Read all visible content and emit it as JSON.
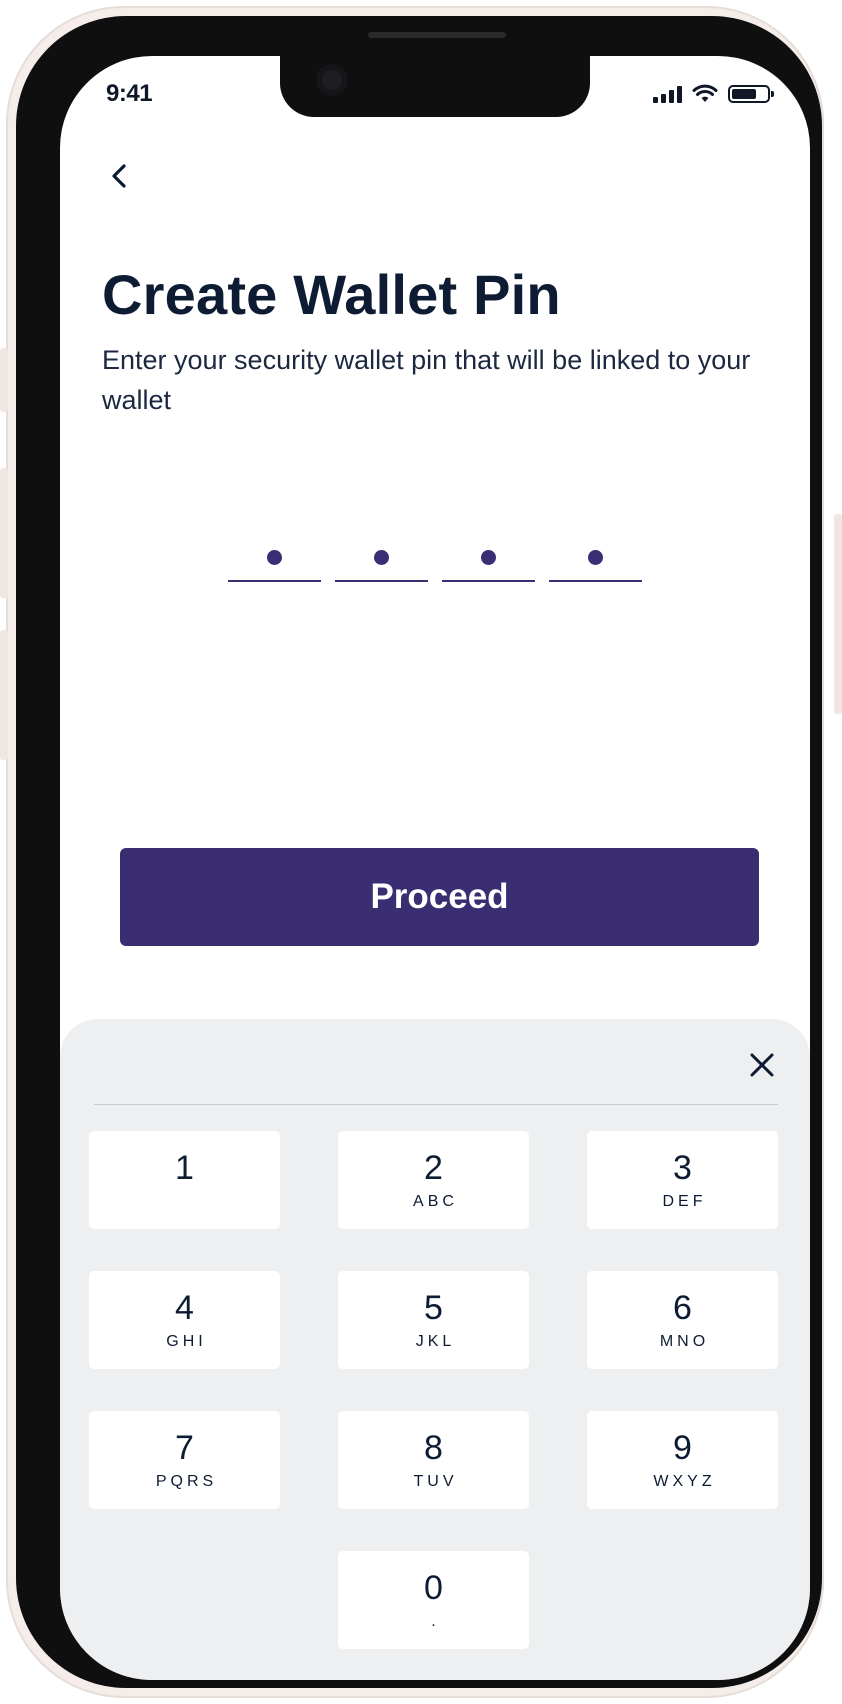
{
  "status_bar": {
    "time": "9:41"
  },
  "header": {
    "title": "Create Wallet Pin",
    "subtitle": "Enter your security wallet pin that will be linked to your wallet"
  },
  "pin": {
    "length": 4,
    "filled": 4
  },
  "actions": {
    "proceed_label": "Proceed"
  },
  "keypad": {
    "keys": [
      {
        "digit": "1",
        "letters": ""
      },
      {
        "digit": "2",
        "letters": "ABC"
      },
      {
        "digit": "3",
        "letters": "DEF"
      },
      {
        "digit": "4",
        "letters": "GHI"
      },
      {
        "digit": "5",
        "letters": "JKL"
      },
      {
        "digit": "6",
        "letters": "MNO"
      },
      {
        "digit": "7",
        "letters": "PQRS"
      },
      {
        "digit": "8",
        "letters": "TUV"
      },
      {
        "digit": "9",
        "letters": "WXYZ"
      },
      {
        "digit": "0",
        "letters": "."
      }
    ]
  },
  "colors": {
    "brand": "#3a2d72",
    "text_dark": "#0d1b33",
    "keypad_bg": "#eeeff1"
  },
  "icons": {
    "back": "chevron-left-icon",
    "close": "close-icon",
    "signal": "cellular-signal-icon",
    "wifi": "wifi-icon",
    "battery": "battery-icon"
  }
}
